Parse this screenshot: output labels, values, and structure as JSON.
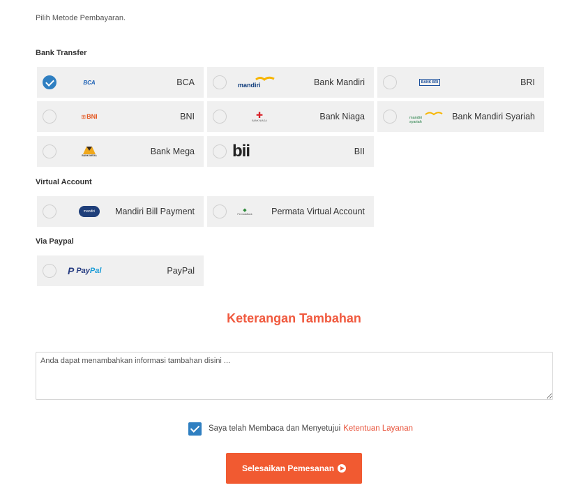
{
  "intro": "Pilih Metode Pembayaran.",
  "sections": {
    "bank_transfer": "Bank Transfer",
    "virtual_account": "Virtual Account",
    "paypal": "Via Paypal"
  },
  "methods": {
    "bca": {
      "label": "BCA",
      "logo": "BCA",
      "selected": true
    },
    "mandiri": {
      "label": "Bank Mandiri",
      "logo": "mandiri"
    },
    "bri": {
      "label": "BRI",
      "logo": "BANK BRI"
    },
    "bni": {
      "label": "BNI",
      "logo": "BNI"
    },
    "niaga": {
      "label": "Bank Niaga",
      "logo": "BANK NIAGA"
    },
    "mandiri_syariah": {
      "label": "Bank Mandiri Syariah",
      "logo": "mandiri syariah"
    },
    "mega": {
      "label": "Bank Mega",
      "logo": "BANK MEGA"
    },
    "bii": {
      "label": "BII",
      "logo": "bii"
    },
    "mandiri_bill": {
      "label": "Mandiri Bill Payment",
      "logo": "mandiri"
    },
    "permata": {
      "label": "Permata Virtual Account",
      "logo": "PermataBank"
    },
    "paypal": {
      "label": "PayPal",
      "logo_pay": "Pay",
      "logo_pal": "Pal"
    }
  },
  "notes": {
    "heading": "Keterangan Tambahan",
    "placeholder": "Anda dapat menambahkan informasi tambahan disini ..."
  },
  "agreement": {
    "checked": true,
    "text": "Saya telah Membaca dan Menyetujui",
    "link": "Ketentuan Layanan"
  },
  "submit_label": "Selesaikan Pemesanan",
  "colors": {
    "accent": "#f15a31",
    "check_blue": "#2f7fc1",
    "card_bg": "#f0f0f0"
  }
}
